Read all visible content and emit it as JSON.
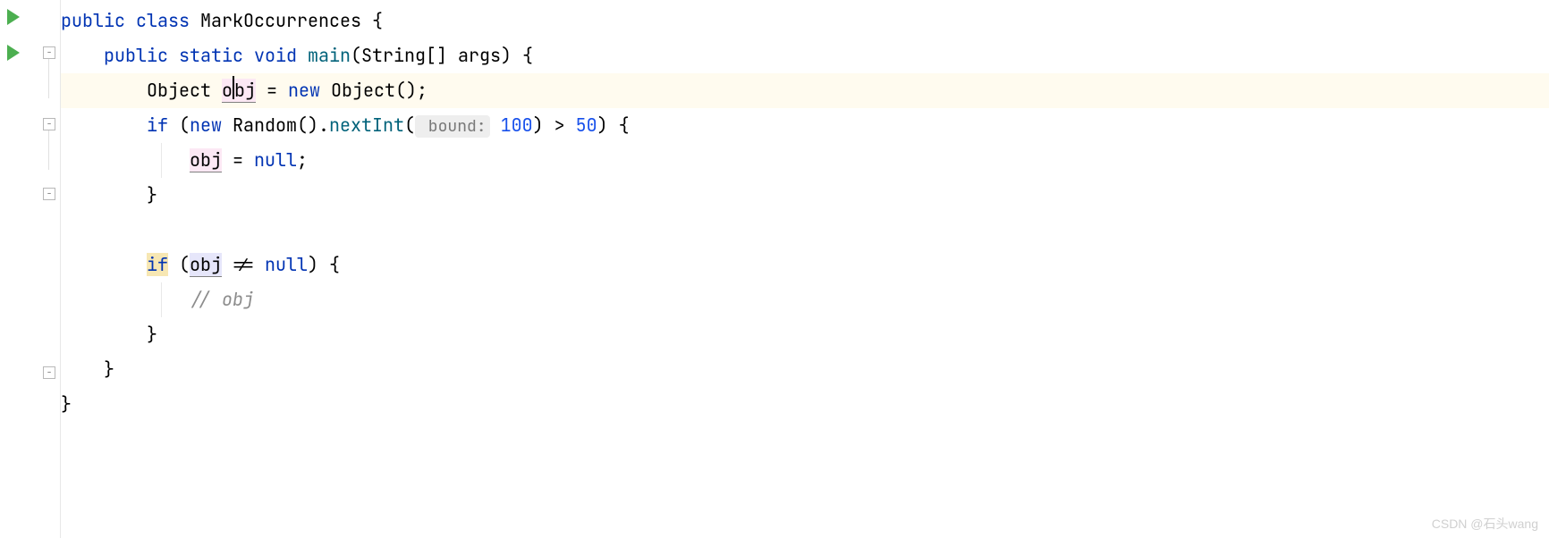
{
  "code": {
    "line1": {
      "kw_public": "public",
      "kw_class": "class",
      "class_name": "MarkOccurrences",
      "brace": " {"
    },
    "line2": {
      "kw_public": "public",
      "kw_static": "static",
      "kw_void": "void",
      "method_name": "main",
      "params": "(String[] args) {"
    },
    "line3": {
      "type": "Object",
      "var_o": "o",
      "var_bj": "bj",
      "equals": " = ",
      "kw_new": "new",
      "ctor": " Object();"
    },
    "line4": {
      "kw_if": "if",
      "open": " (",
      "kw_new": "new",
      "random": " Random().",
      "method": "nextInt",
      "paren_open": "(",
      "hint": " bound:",
      "num": " 100",
      "close": ") > ",
      "fifty": "50",
      "end": ") {"
    },
    "line5": {
      "var": "obj",
      "rest": " = ",
      "kw_null": "null",
      "semi": ";"
    },
    "line6": {
      "brace": "}"
    },
    "line8": {
      "kw_if": "if",
      "open": " (",
      "var": "obj",
      "rest": " != ",
      "kw_null": "null",
      "end": ") {"
    },
    "line9": {
      "comment": "// obj"
    },
    "line10": {
      "brace": "}"
    },
    "line11": {
      "brace": "}"
    },
    "line12": {
      "brace": "}"
    }
  },
  "watermark": "CSDN @石头wang"
}
